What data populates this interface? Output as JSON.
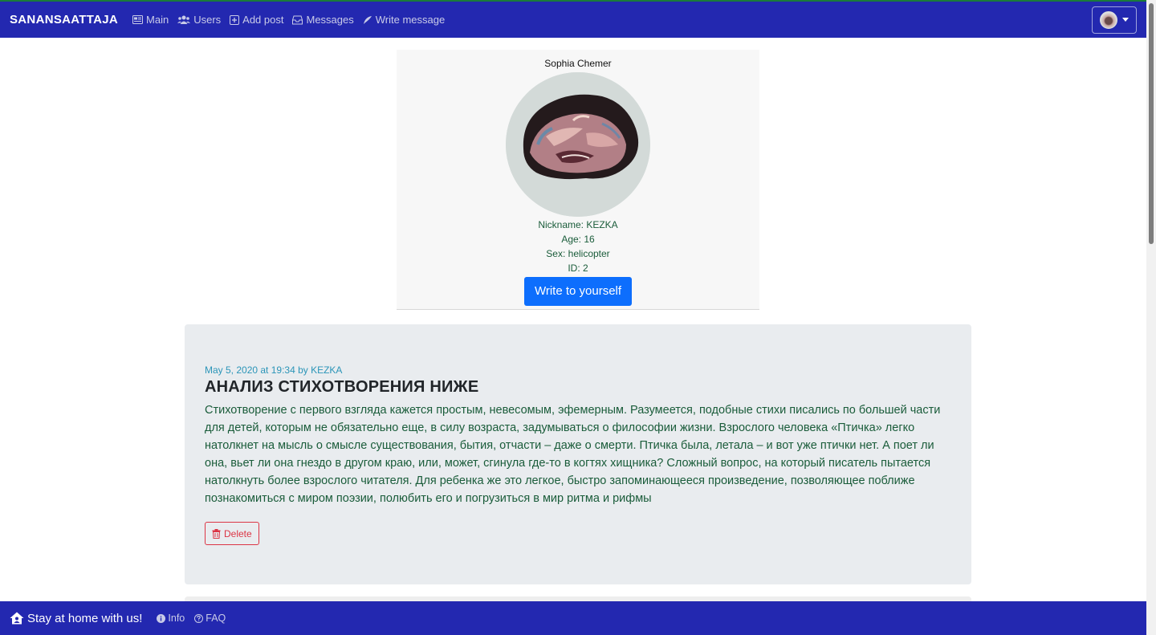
{
  "navbar": {
    "brand": "SANANSAATTAJA",
    "links": [
      {
        "label": "Main",
        "icon": "newspaper-icon"
      },
      {
        "label": "Users",
        "icon": "users-icon"
      },
      {
        "label": "Add post",
        "icon": "plus-square-icon"
      },
      {
        "label": "Messages",
        "icon": "inbox-icon"
      },
      {
        "label": "Write message",
        "icon": "feather-icon"
      }
    ]
  },
  "profile": {
    "name": "Sophia Chemer",
    "nickname": "Nickname: KEZKA",
    "age": "Age: 16",
    "sex": "Sex: helicopter",
    "id": "ID: 2",
    "write_button": "Write to yourself"
  },
  "post": {
    "meta": "May 5, 2020 at 19:34 by KEZKA",
    "title": "АНАЛИЗ СТИХОТВОРЕНИЯ НИЖЕ",
    "body": "Стихотворение с первого взгляда кажется простым, невесомым, эфемерным. Разумеется, подобные стихи писались по большей части для детей, которым не обязательно еще, в силу возраста, задумываться о философии жизни. Взрослого человека «Птичка» легко натолкнет на мысль о смысле существования, бытия, отчасти – даже о смерти. Птичка была, летала – и вот уже птички нет. А поет ли она, вьет ли она гнездо в другом краю, или, может, сгинула где-то в когтях хищника? Сложный вопрос, на который писатель пытается натолкнуть более взрослого читателя. Для ребенка же это легкое, быстро запоминающееся произведение, позволяющее поближе познакомиться с миром поэзии, полюбить его и погрузиться в мир ритма и рифмы",
    "delete_label": "Delete"
  },
  "footer": {
    "brand": "Stay at home with us!",
    "links": [
      {
        "label": "Info",
        "icon": "info-circle-icon"
      },
      {
        "label": "FAQ",
        "icon": "question-circle-icon"
      }
    ]
  },
  "colors": {
    "navbar_bg": "#2328b0",
    "primary_button": "#0d6efd",
    "danger": "#dc3545",
    "meta_text": "#2b95b8",
    "body_text": "#1a5c3a"
  }
}
